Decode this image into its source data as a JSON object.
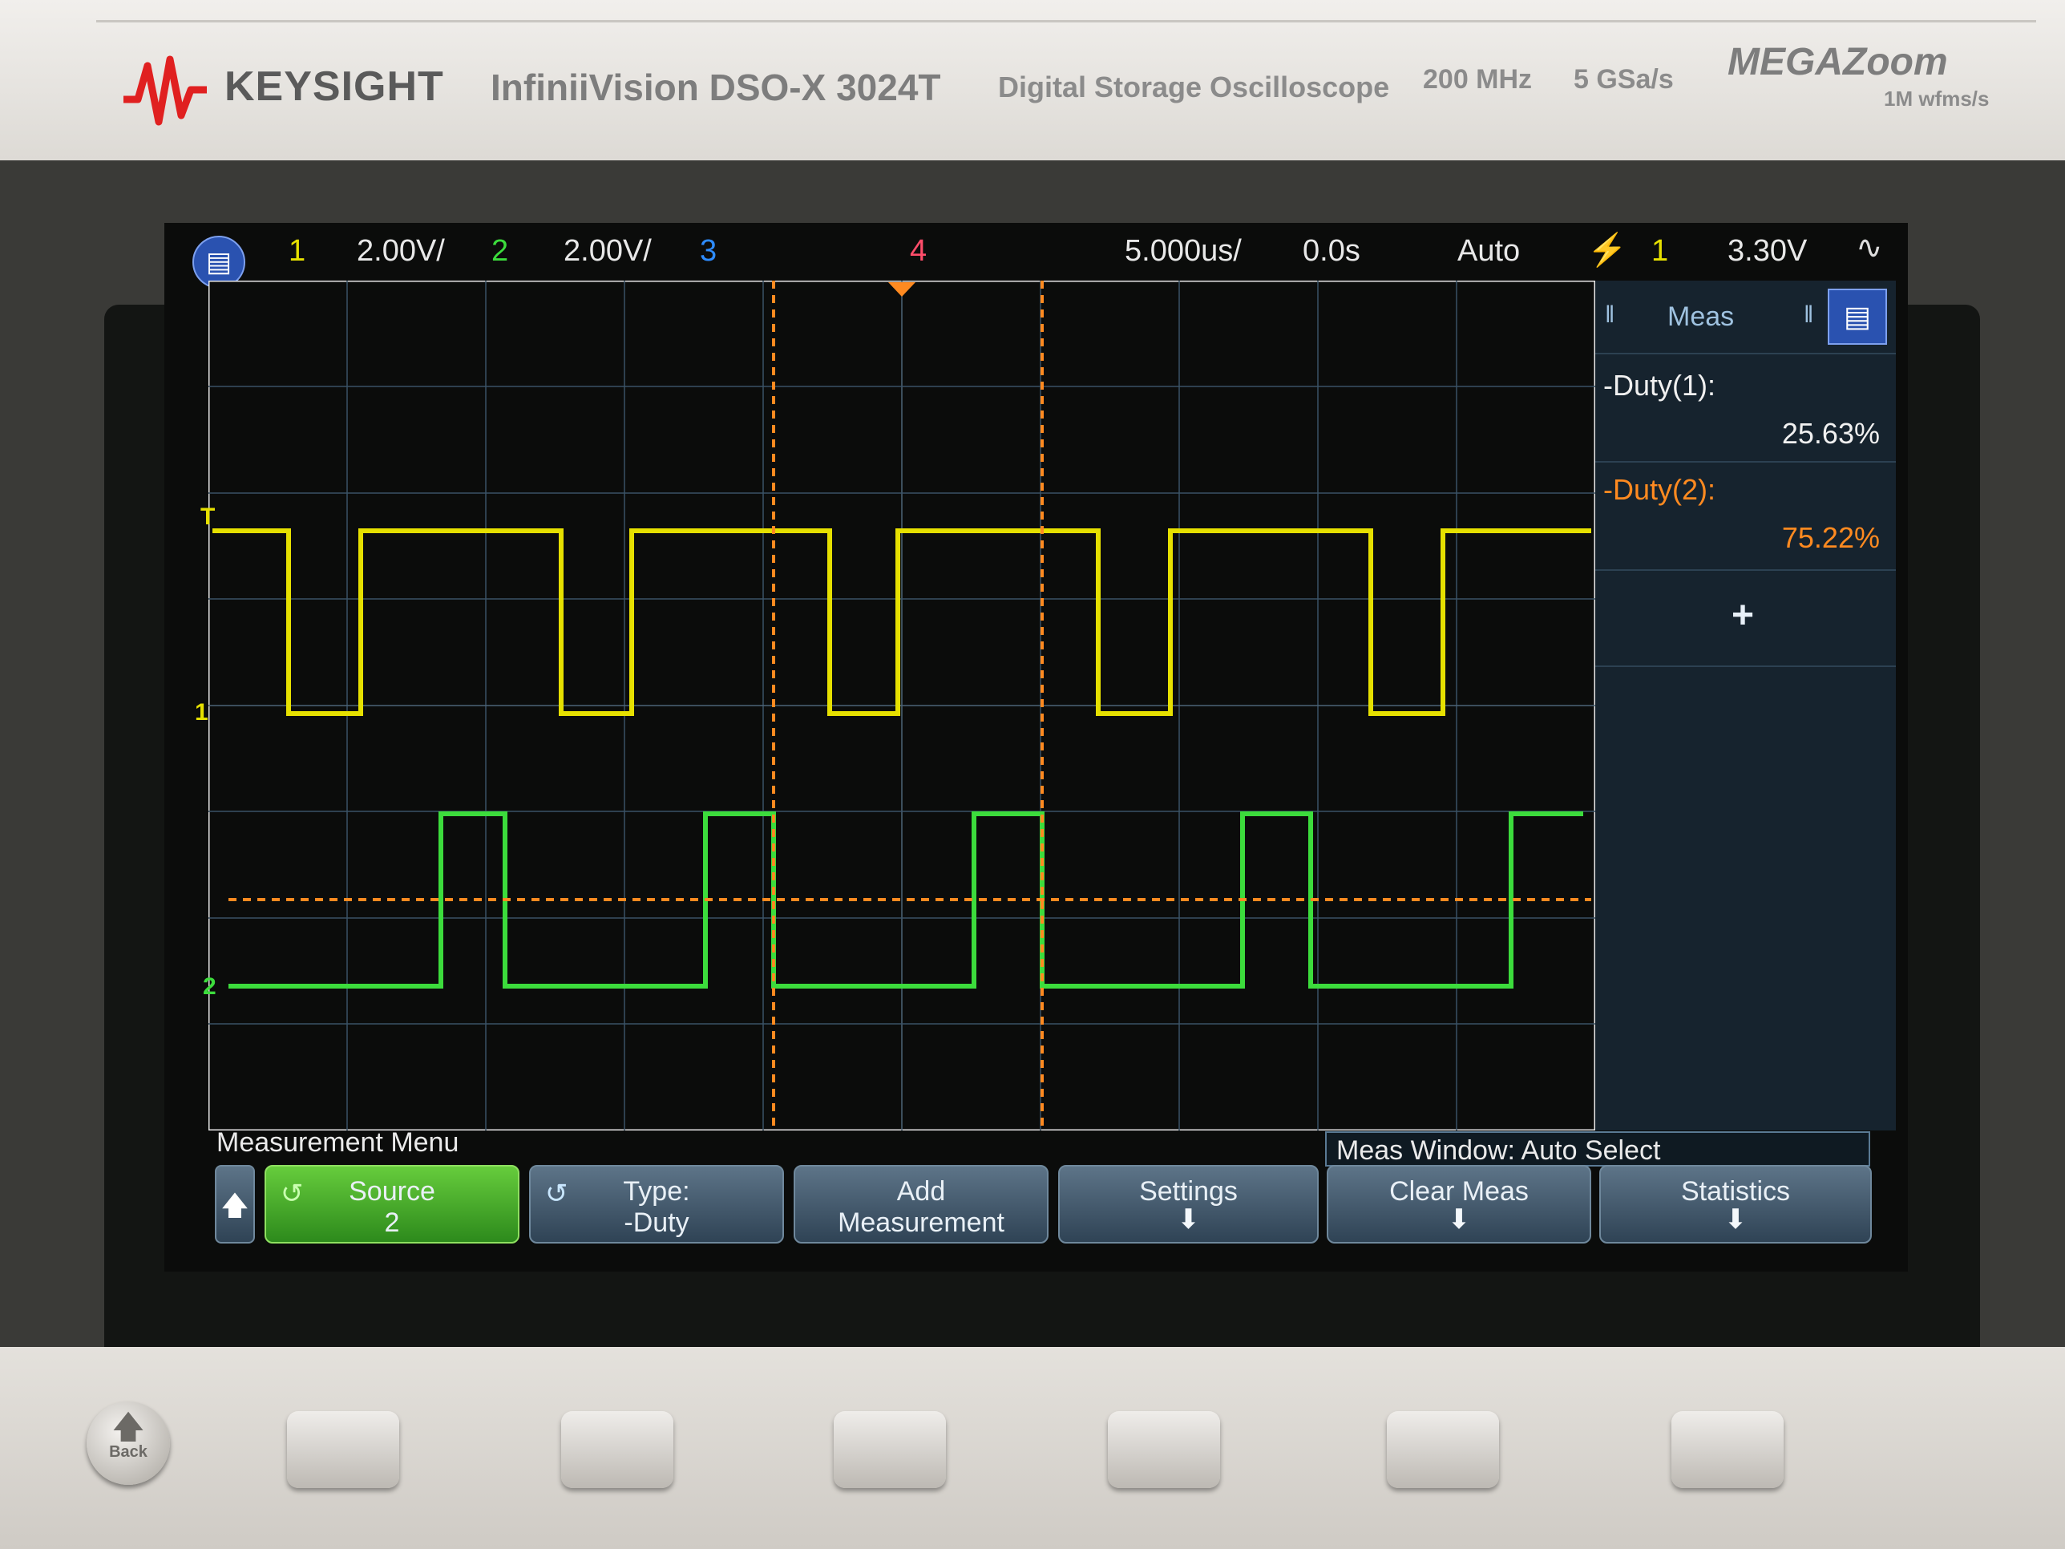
{
  "instrument": {
    "brand": "KEYSIGHT",
    "model": "InfiniiVision DSO-X 3024T",
    "description": "Digital Storage Oscilloscope",
    "bandwidth": "200 MHz",
    "sample_rate": "5 GSa/s",
    "megazoom": "MEGAZoom",
    "megazoom_sub": "1M wfms/s",
    "back_label": "Back"
  },
  "status_bar": {
    "ch1_num": "1",
    "ch1_scale": "2.00V/",
    "ch2_num": "2",
    "ch2_scale": "2.00V/",
    "ch3_num": "3",
    "ch4_num": "4",
    "timebase": "5.000us/",
    "delay": "0.0s",
    "trigger_mode": "Auto",
    "trigger_source": "1",
    "trigger_level": "3.30V"
  },
  "channel_markers": {
    "ch1": "1",
    "ch2": "2",
    "trigger": "T"
  },
  "meas_panel": {
    "title": "Meas",
    "items": [
      {
        "label": "-Duty(1):",
        "value": "25.63%",
        "color": "#f0f0f0"
      },
      {
        "label": "-Duty(2):",
        "value": "75.22%",
        "color": "#ff8a20"
      }
    ],
    "add_symbol": "+"
  },
  "menu": {
    "title": "Measurement Menu",
    "window_select": "Meas Window: Auto Select",
    "buttons": {
      "source_l1": "Source",
      "source_l2": "2",
      "type_l1": "Type:",
      "type_l2": "-Duty",
      "add_l1": "Add",
      "add_l2": "Measurement",
      "settings": "Settings",
      "clear": "Clear Meas",
      "statistics": "Statistics"
    }
  },
  "colors": {
    "ch1": "#e6e000",
    "ch2": "#3cdc3c",
    "ch3": "#2e8cff",
    "ch4": "#ff4d6a",
    "cursor": "#ff8a20",
    "screen_bg": "#0b0c0b"
  }
}
